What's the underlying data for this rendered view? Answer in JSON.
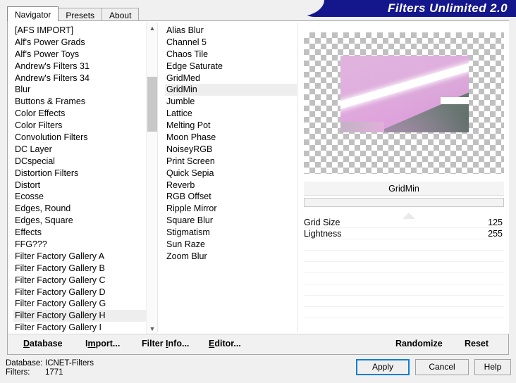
{
  "banner": {
    "title": "Filters Unlimited 2.0"
  },
  "tabs": [
    {
      "label": "Navigator",
      "active": true
    },
    {
      "label": "Presets",
      "active": false
    },
    {
      "label": "About",
      "active": false
    }
  ],
  "categories": {
    "selected": "Filter Factory Gallery H",
    "items": [
      "[AFS IMPORT]",
      "Alf's Power Grads",
      "Alf's Power Toys",
      "Andrew's Filters 31",
      "Andrew's Filters 34",
      "Blur",
      "Buttons & Frames",
      "Color Effects",
      "Color Filters",
      "Convolution Filters",
      "DC Layer",
      "DCspecial",
      "Distortion Filters",
      "Distort",
      "Ecosse",
      "Edges, Round",
      "Edges, Square",
      "Effects",
      "FFG???",
      "Filter Factory Gallery A",
      "Filter Factory Gallery B",
      "Filter Factory Gallery C",
      "Filter Factory Gallery D",
      "Filter Factory Gallery G",
      "Filter Factory Gallery H",
      "Filter Factory Gallery I"
    ]
  },
  "filters": {
    "selected": "GridMin",
    "items": [
      "Alias Blur",
      "Channel 5",
      "Chaos Tile",
      "Edge Saturate",
      "GridMed",
      "GridMin",
      "Jumble",
      "Lattice",
      "Melting Pot",
      "Moon Phase",
      "NoiseyRGB",
      "Print Screen",
      "Quick Sepia",
      "Reverb",
      "RGB Offset",
      "Ripple Mirror",
      "Square Blur",
      "Stigmatism",
      "Sun Raze",
      "Zoom Blur"
    ]
  },
  "params": {
    "header": "GridMin",
    "rows": [
      {
        "name": "Grid Size",
        "value": "125"
      },
      {
        "name": "Lightness",
        "value": "255"
      }
    ]
  },
  "toolbar": {
    "database": {
      "pre": "",
      "key": "D",
      "post": "atabase"
    },
    "import": {
      "pre": "I",
      "key": "m",
      "post": "port..."
    },
    "filterinfo": {
      "pre": "Filter ",
      "key": "I",
      "post": "nfo..."
    },
    "editor": {
      "pre": "",
      "key": "E",
      "post": "ditor..."
    },
    "randomize": "Randomize",
    "reset": "Reset"
  },
  "status": {
    "database_label": "Database:",
    "database_value": "ICNET-Filters",
    "filters_label": "Filters:",
    "filters_value": "1771"
  },
  "buttons": {
    "apply": "Apply",
    "cancel": "Cancel",
    "help": "Help"
  },
  "colors": {
    "banner_bg": "#14178c",
    "accent_focus": "#0b7fd4",
    "selection_bg": "#eeeeee",
    "checker": "#c0c0c0"
  }
}
